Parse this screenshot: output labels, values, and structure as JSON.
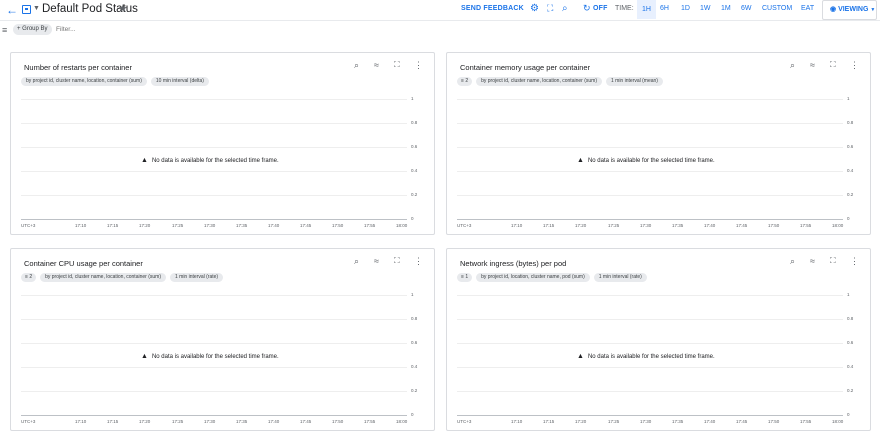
{
  "header": {
    "title": "Default Pod Status",
    "send_feedback": "SEND FEEDBACK",
    "refresh_label": "OFF",
    "time_label": "TIME:",
    "ranges": [
      "1H",
      "6H",
      "1D",
      "1W",
      "1M",
      "6W",
      "CUSTOM"
    ],
    "selected_range": "1H",
    "timezone": "EAT",
    "viewing": "VIEWING"
  },
  "filterbar": {
    "group_by": "+ Group By",
    "filter_placeholder": "Filter..."
  },
  "common": {
    "no_data": "No data is available for the selected time frame.",
    "y_ticks": [
      "1",
      "0.8",
      "0.6",
      "0.4",
      "0.2",
      "0"
    ],
    "x_ticks": [
      "UTC+3",
      "17:10",
      "17:15",
      "17:20",
      "17:25",
      "17:30",
      "17:35",
      "17:40",
      "17:45",
      "17:50",
      "17:55",
      "18:00"
    ]
  },
  "cards": [
    {
      "title": "Number of restarts per container",
      "filter_count": "",
      "chips": [
        "by project id, cluster name, location, container (sum)",
        "10 min interval (delta)"
      ]
    },
    {
      "title": "Container memory usage per container",
      "filter_count": "2",
      "chips": [
        "by project id, cluster name, location, container (sum)",
        "1 min interval (mean)"
      ]
    },
    {
      "title": "Container CPU usage per container",
      "filter_count": "2",
      "chips": [
        "by project id, cluster name, location, container (sum)",
        "1 min interval (rate)"
      ]
    },
    {
      "title": "Network ingress (bytes) per pod",
      "filter_count": "1",
      "chips": [
        "by project id, location, cluster name, pod (sum)",
        "1 min interval (rate)"
      ]
    }
  ],
  "colors": {
    "accent": "#1a73e8",
    "selected_bg": "#e8f0fe",
    "chip_bg": "#e8eaed"
  }
}
